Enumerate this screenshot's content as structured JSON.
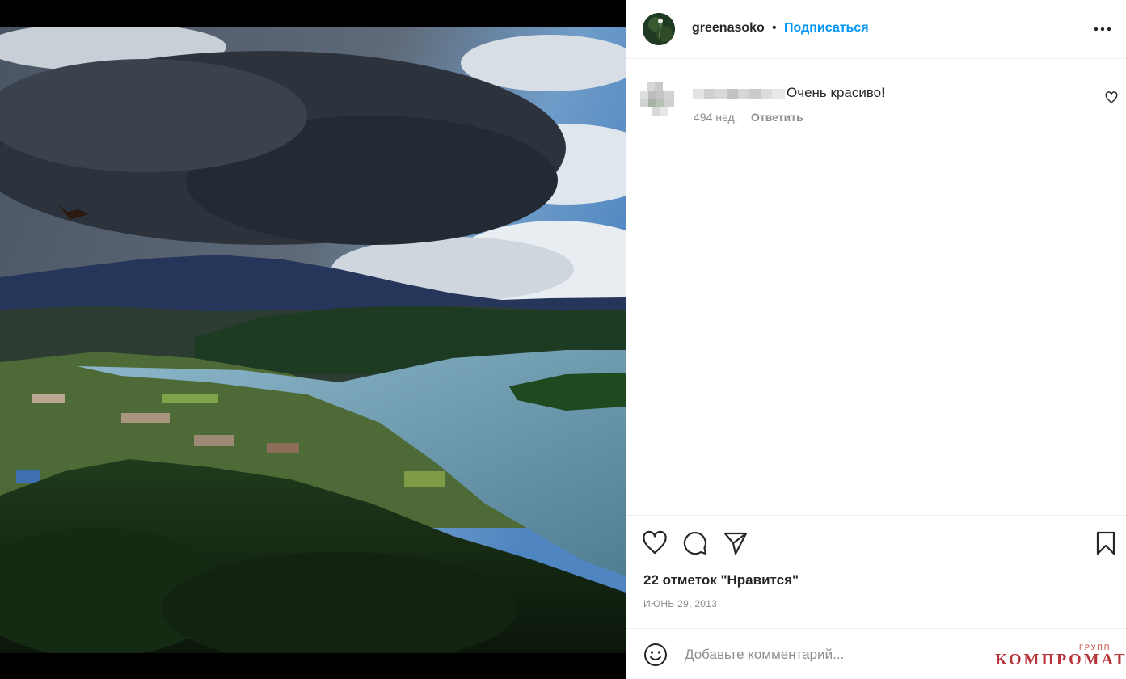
{
  "post": {
    "username": "greenasoko",
    "separator": "•",
    "follow_label": "Подписаться",
    "more_icon": "more-horizontal-icon"
  },
  "comments": [
    {
      "text": "Очень красиво!",
      "age": "494 нед.",
      "reply_label": "Ответить"
    }
  ],
  "actions": {
    "icons": [
      "heart-icon",
      "comment-icon",
      "share-icon",
      "bookmark-icon"
    ],
    "likes_text": "22 отметок \"Нравится\"",
    "date": "ИЮНЬ 29, 2013"
  },
  "add_comment": {
    "placeholder": "Добавьте комментарий..."
  },
  "watermark": {
    "top": "ГРУПП",
    "main": "КОМПРОМАТ"
  },
  "colors": {
    "link": "#0095f6",
    "muted": "#8e8e8e",
    "text": "#262626",
    "watermark": "#b7343c"
  }
}
